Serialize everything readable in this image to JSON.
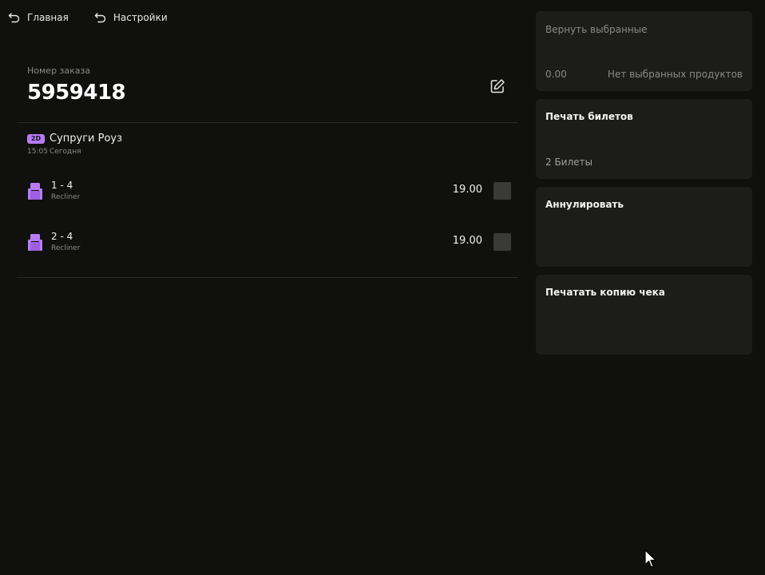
{
  "nav": {
    "home_label": "Главная",
    "settings_label": "Настройки"
  },
  "order": {
    "label": "Номер заказа",
    "number": "5959418"
  },
  "movie": {
    "format": "2D",
    "title": "Супруги Роуз",
    "time": "15:05",
    "day": "Сегодня"
  },
  "tickets": [
    {
      "seat": "1 - 4",
      "type": "Recliner",
      "price": "19.00",
      "checked": false
    },
    {
      "seat": "2 - 4",
      "type": "Recliner",
      "price": "19.00",
      "checked": false
    }
  ],
  "actions": {
    "return": {
      "title": "Вернуть выбранные",
      "amount": "0.00",
      "status": "Нет выбранных продуктов"
    },
    "print_tickets": {
      "title": "Печать билетов",
      "sub": "2 Билеты"
    },
    "cancel": {
      "title": "Аннулировать"
    },
    "print_receipt": {
      "title": "Печатать копию чека"
    }
  },
  "colors": {
    "background": "#10100e",
    "card": "#1c1c1a",
    "accent": "#b77cf2",
    "muted_text": "#8a8a88"
  }
}
